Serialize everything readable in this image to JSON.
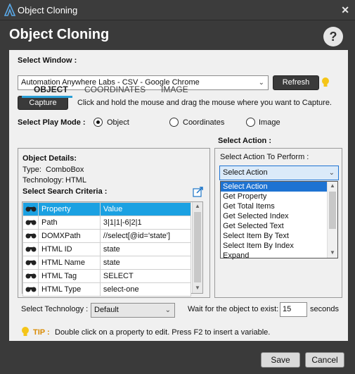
{
  "window": {
    "title": "Object Cloning",
    "heading": "Object Cloning",
    "help": "?",
    "close": "✕"
  },
  "select_window": {
    "label": "Select Window :",
    "value": "Automation Anywhere Labs - CSV - Google Chrome",
    "refresh_label": "Refresh",
    "capture_label": "Capture",
    "capture_hint": "Click and hold the mouse and drag the mouse where you want to Capture."
  },
  "play_mode": {
    "label": "Select Play Mode :",
    "options": [
      "Object",
      "Coordinates",
      "Image"
    ],
    "selected": "Object"
  },
  "tabs": [
    "OBJECT",
    "COORDINATES",
    "IMAGE"
  ],
  "object_details": {
    "heading": "Object Details:",
    "type_label": "Type:",
    "type_value": "ComboBox",
    "tech_label": "Technology:",
    "tech_value": "HTML",
    "criteria_label": "Select Search Criteria :"
  },
  "criteria_table": {
    "headers": [
      "Property",
      "Value"
    ],
    "rows": [
      {
        "property": "Path",
        "value": "3|1|1|-6|2|1"
      },
      {
        "property": "DOMXPath",
        "value": "//select[@id='state']"
      },
      {
        "property": "HTML ID",
        "value": "state"
      },
      {
        "property": "HTML Name",
        "value": "state"
      },
      {
        "property": "HTML Tag",
        "value": "SELECT"
      },
      {
        "property": "HTML Type",
        "value": "select-one"
      }
    ]
  },
  "select_action": {
    "label": "Select Action :",
    "perform_label": "Select Action To Perform :",
    "value": "Select Action",
    "options": [
      "Select Action",
      "Get Property",
      "Get Total Items",
      "Get Selected Index",
      "Get Selected Text",
      "Select Item By Text",
      "Select Item By Index",
      "Expand"
    ]
  },
  "technology": {
    "label": "Select Technology :",
    "value": "Default"
  },
  "wait": {
    "label": "Wait for the object to exist:",
    "value": "15",
    "unit": "seconds"
  },
  "tip": {
    "label": "TIP :",
    "text": "Double click on a property to edit. Press F2 to insert a variable."
  },
  "footer": {
    "save": "Save",
    "cancel": "Cancel"
  }
}
